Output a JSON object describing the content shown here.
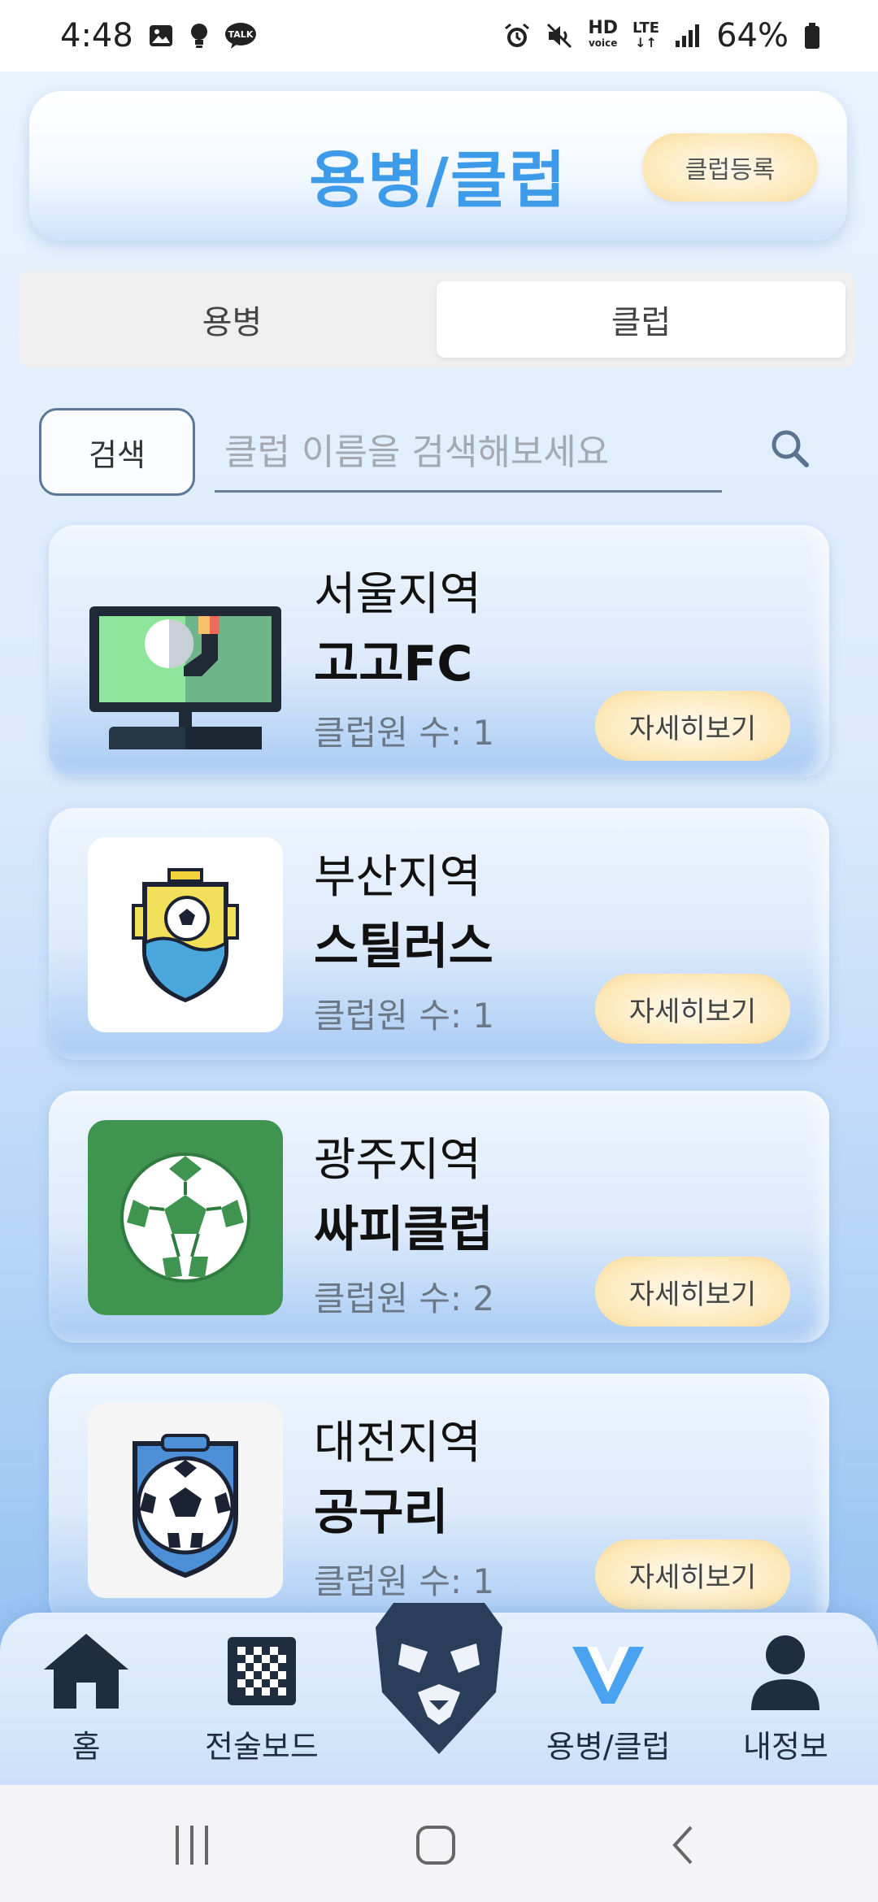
{
  "status_bar": {
    "time": "4:48",
    "battery": "64%",
    "talk_badge": "TALK",
    "hd_label": "HD",
    "voice_label": "voice",
    "lte_label": "LTE"
  },
  "header": {
    "title": "용병/클럽",
    "register_button": "클럽등록"
  },
  "tabs": [
    {
      "label": "용병",
      "active": false
    },
    {
      "label": "클럽",
      "active": true
    }
  ],
  "search": {
    "button_label": "검색",
    "placeholder": "클럽 이름을 검색해보세요",
    "value": ""
  },
  "clubs": [
    {
      "region": "서울지역",
      "name": "고고FC",
      "members": "클럽원 수: 1",
      "detail_label": "자세히보기",
      "logo": "monitor-football-icon"
    },
    {
      "region": "부산지역",
      "name": "스틸러스",
      "members": "클럽원 수: 1",
      "detail_label": "자세히보기",
      "logo": "ship-shield-ball-icon"
    },
    {
      "region": "광주지역",
      "name": "싸피클럽",
      "members": "클럽원 수: 2",
      "detail_label": "자세히보기",
      "logo": "green-soccer-ball-icon"
    },
    {
      "region": "대전지역",
      "name": "공구리",
      "members": "클럽원 수: 1",
      "detail_label": "자세히보기",
      "logo": "blue-shield-ball-icon"
    }
  ],
  "bottom_nav": [
    {
      "label": "홈",
      "icon": "home-icon"
    },
    {
      "label": "전술보드",
      "icon": "checkerboard-icon"
    },
    {
      "label": "",
      "icon": "lion-logo-icon"
    },
    {
      "label": "용병/클럽",
      "icon": "v-logo-icon"
    },
    {
      "label": "내정보",
      "icon": "person-icon"
    }
  ],
  "colors": {
    "accent": "#3d9be9",
    "button_yellow": "#fde8b8",
    "nav_dark": "#1e2d40"
  }
}
